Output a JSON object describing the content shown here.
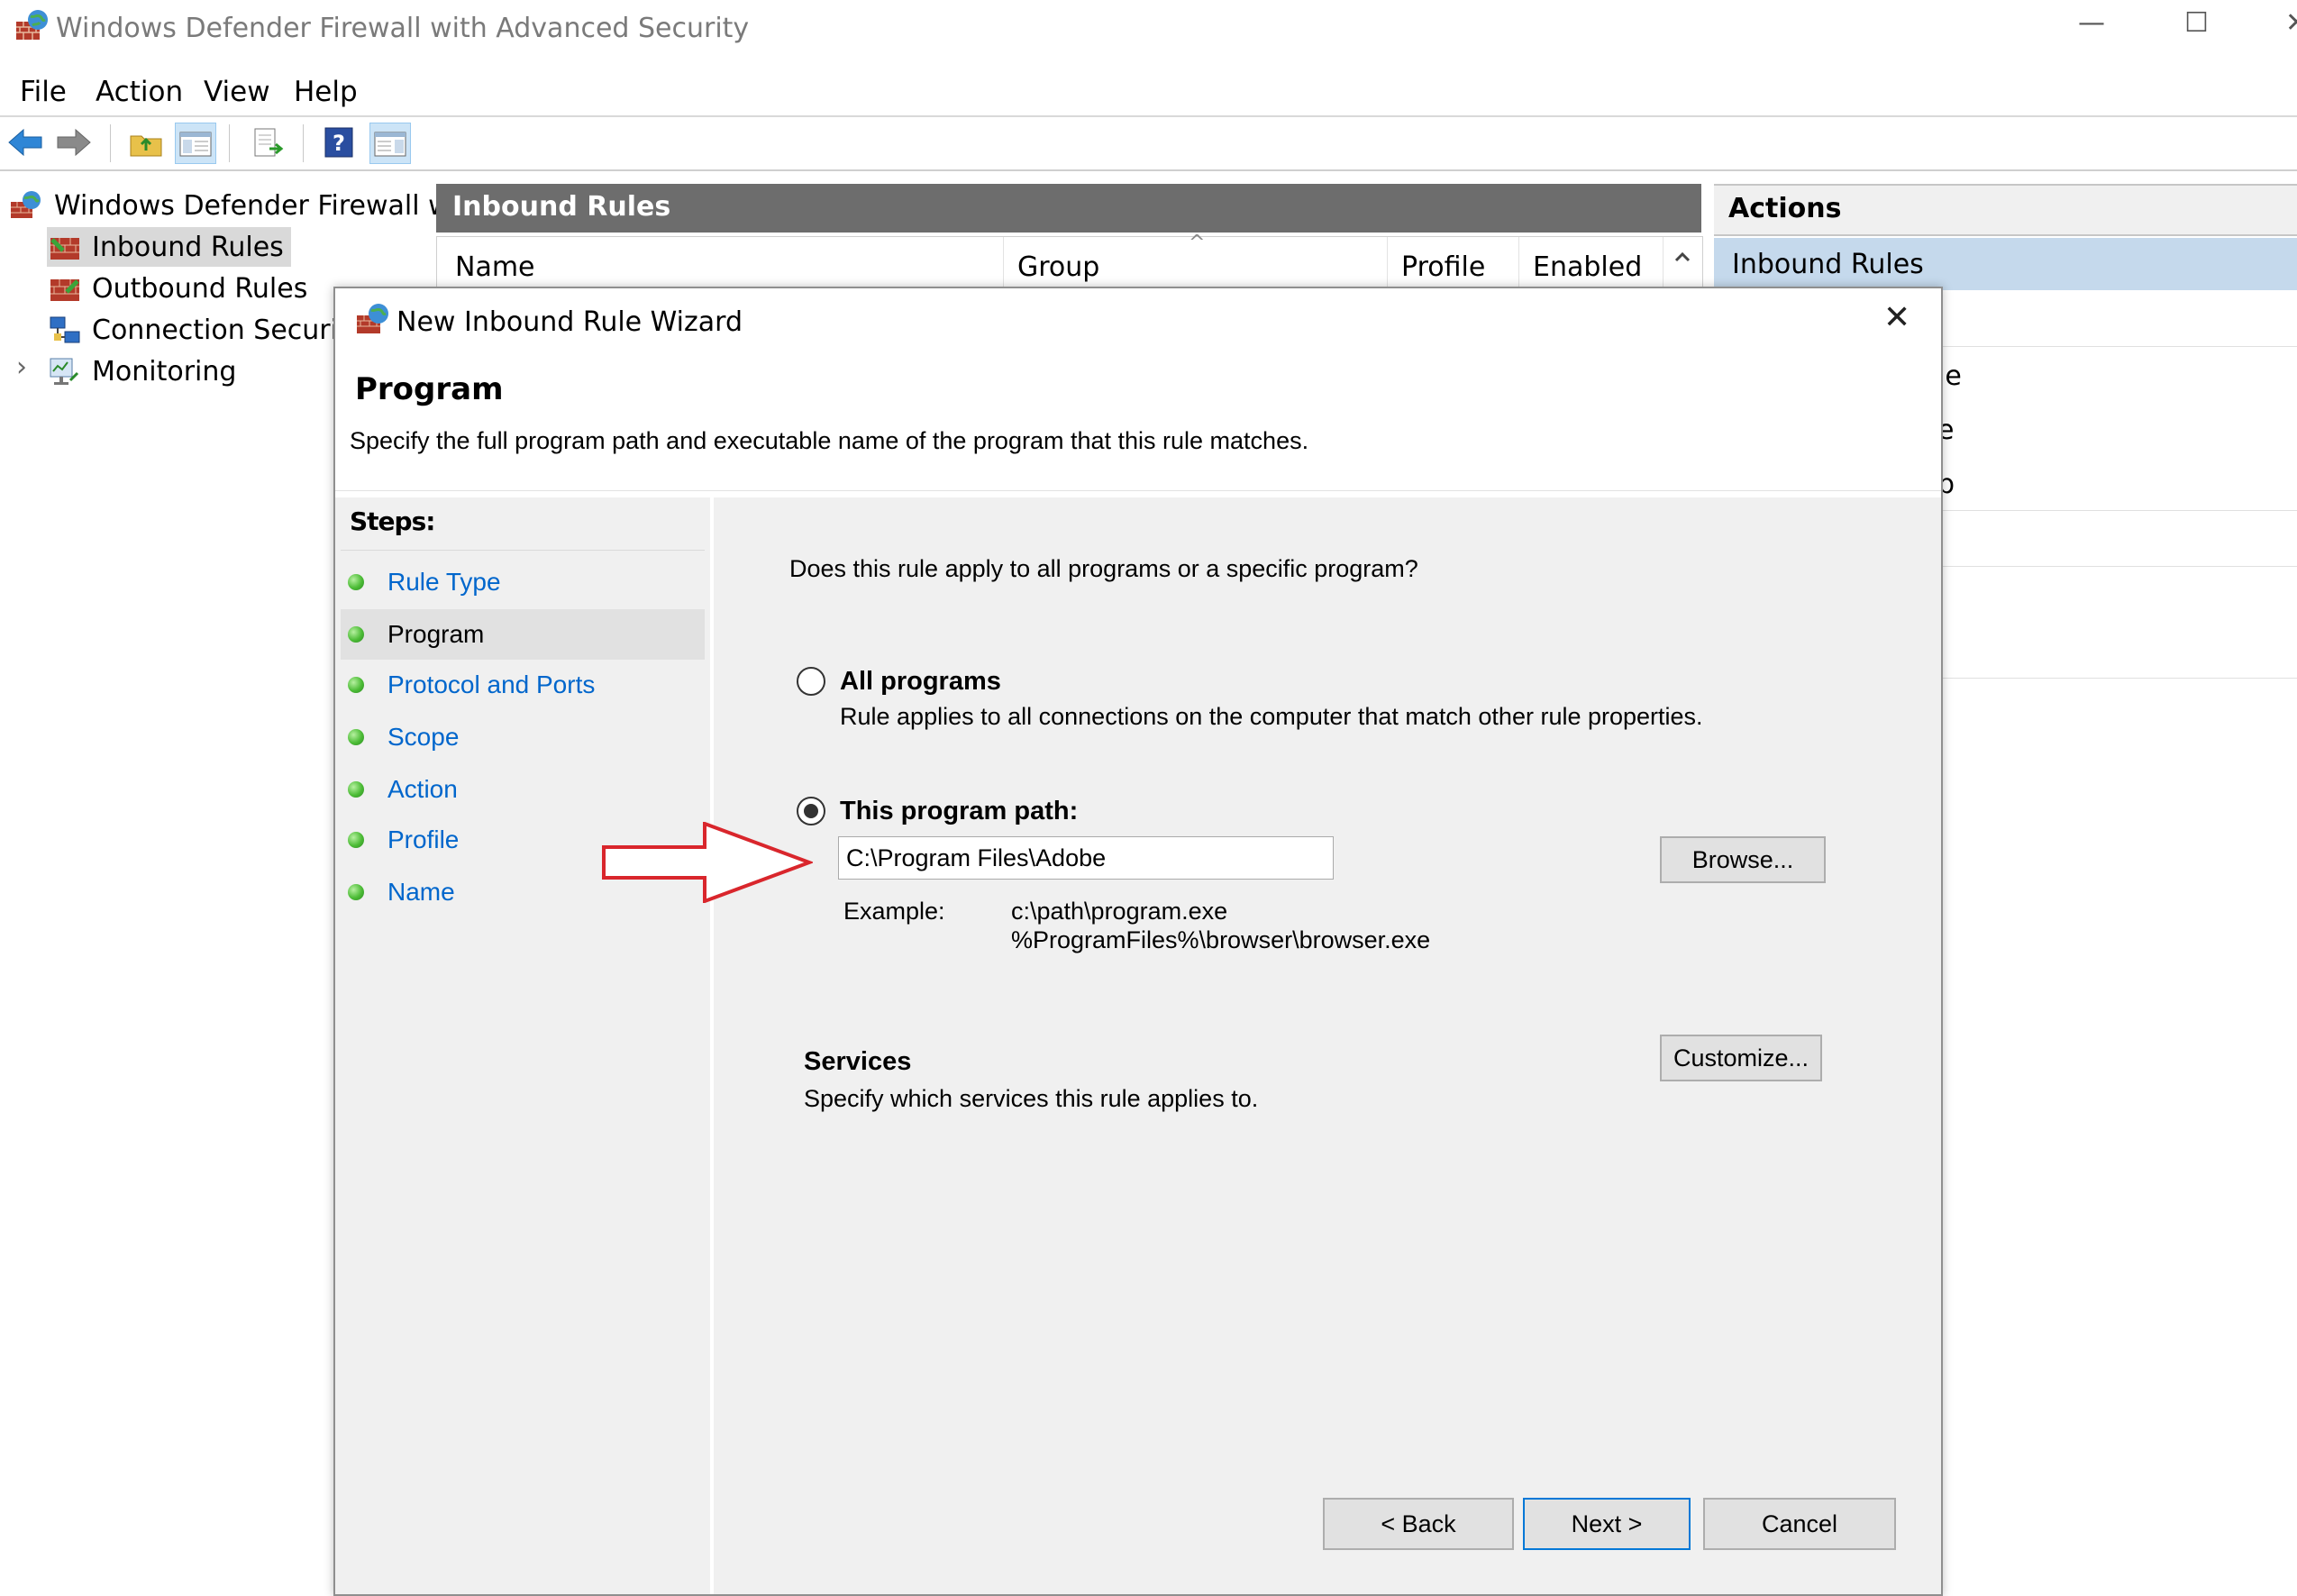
{
  "window": {
    "title": "Windows Defender Firewall with Advanced Security",
    "minimize_glyph": "—",
    "maximize_glyph": "☐",
    "close_glyph": "✕"
  },
  "menu": [
    "File",
    "Action",
    "View",
    "Help"
  ],
  "toolbar": {
    "icons": [
      "back-arrow-icon",
      "forward-arrow-icon",
      "up-folder-icon",
      "show-hide-tree-icon",
      "export-list-icon",
      "help-icon",
      "show-hide-action-pane-icon"
    ]
  },
  "tree": {
    "root": "Windows Defender Firewall with",
    "items": [
      {
        "label": "Inbound Rules",
        "selected": true
      },
      {
        "label": "Outbound Rules",
        "selected": false
      },
      {
        "label": "Connection Security R",
        "selected": false
      },
      {
        "label": "Monitoring",
        "selected": false
      }
    ],
    "expand_glyph": "›"
  },
  "center": {
    "title": "Inbound Rules",
    "columns": [
      "Name",
      "Group",
      "Profile",
      "Enabled"
    ],
    "sort_glyph": "^"
  },
  "actions": {
    "title": "Actions",
    "selected": "Inbound Rules",
    "fragments": [
      "le",
      "e",
      "p"
    ]
  },
  "dialog": {
    "title": "New Inbound Rule Wizard",
    "close_glyph": "✕",
    "page_title": "Program",
    "page_description": "Specify the full program path and executable name of the program that this rule matches.",
    "steps_title": "Steps:",
    "steps": [
      {
        "label": "Rule Type",
        "current": false
      },
      {
        "label": "Program",
        "current": true
      },
      {
        "label": "Protocol and Ports",
        "current": false
      },
      {
        "label": "Scope",
        "current": false
      },
      {
        "label": "Action",
        "current": false
      },
      {
        "label": "Profile",
        "current": false
      },
      {
        "label": "Name",
        "current": false
      }
    ],
    "question": "Does this rule apply to all programs or a specific program?",
    "all_programs": {
      "label": "All programs",
      "description": "Rule applies to all connections on the computer that match other rule properties.",
      "selected": false
    },
    "this_program": {
      "label": "This program path:",
      "selected": true,
      "value": "C:\\Program Files\\Adobe",
      "browse_label": "Browse...",
      "example_label": "Example:",
      "example_1": "c:\\path\\program.exe",
      "example_2": "%ProgramFiles%\\browser\\browser.exe"
    },
    "services": {
      "title": "Services",
      "description": "Specify which services this rule applies to.",
      "button": "Customize..."
    },
    "buttons": {
      "back": "< Back",
      "next": "Next >",
      "cancel": "Cancel"
    }
  },
  "colors": {
    "link_blue": "#0066cc",
    "header_gray": "#6d6d6d",
    "selection_blue": "#c5d9ec",
    "annotation_red": "#d9262c"
  }
}
